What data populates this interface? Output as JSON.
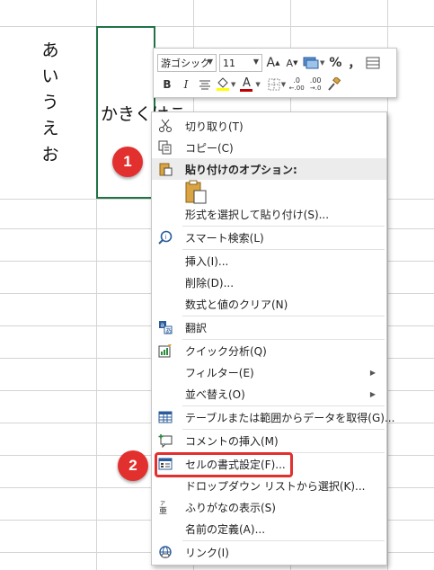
{
  "sheet": {
    "column_a_chars": [
      "あ",
      "い",
      "う",
      "え",
      "お"
    ],
    "selected_cell_text": "かきくけこ"
  },
  "mini_toolbar": {
    "font_name": "游ゴシック",
    "font_size": "11",
    "grow_font": "A",
    "shrink_font": "A",
    "percent": "%",
    "comma": "，",
    "bold": "B",
    "italic": "I",
    "font_color_letter": "A",
    "decrease_decimal": ".00",
    "increase_decimal": ".0"
  },
  "menu": {
    "cut": "切り取り(T)",
    "copy": "コピー(C)",
    "paste_options": "貼り付けのオプション:",
    "paste_special": "形式を選択して貼り付け(S)...",
    "smart_lookup": "スマート検索(L)",
    "insert": "挿入(I)...",
    "delete": "削除(D)...",
    "clear_contents": "数式と値のクリア(N)",
    "translate": "翻訳",
    "quick_analysis": "クイック分析(Q)",
    "filter": "フィルター(E)",
    "sort": "並べ替え(O)",
    "get_data": "テーブルまたは範囲からデータを取得(G)...",
    "insert_comment": "コメントの挿入(M)",
    "format_cells": "セルの書式設定(F)...",
    "pick_from_list": "ドロップダウン リストから選択(K)...",
    "show_phonetic": "ふりがなの表示(S)",
    "define_name": "名前の定義(A)...",
    "link": "リンク(I)"
  },
  "callouts": {
    "step1": "1",
    "step2": "2"
  },
  "colors": {
    "selection_border": "#217346",
    "callout_red": "#e2302f",
    "font_color_bar": "#c00000",
    "fill_color_bar": "#ffff00"
  }
}
